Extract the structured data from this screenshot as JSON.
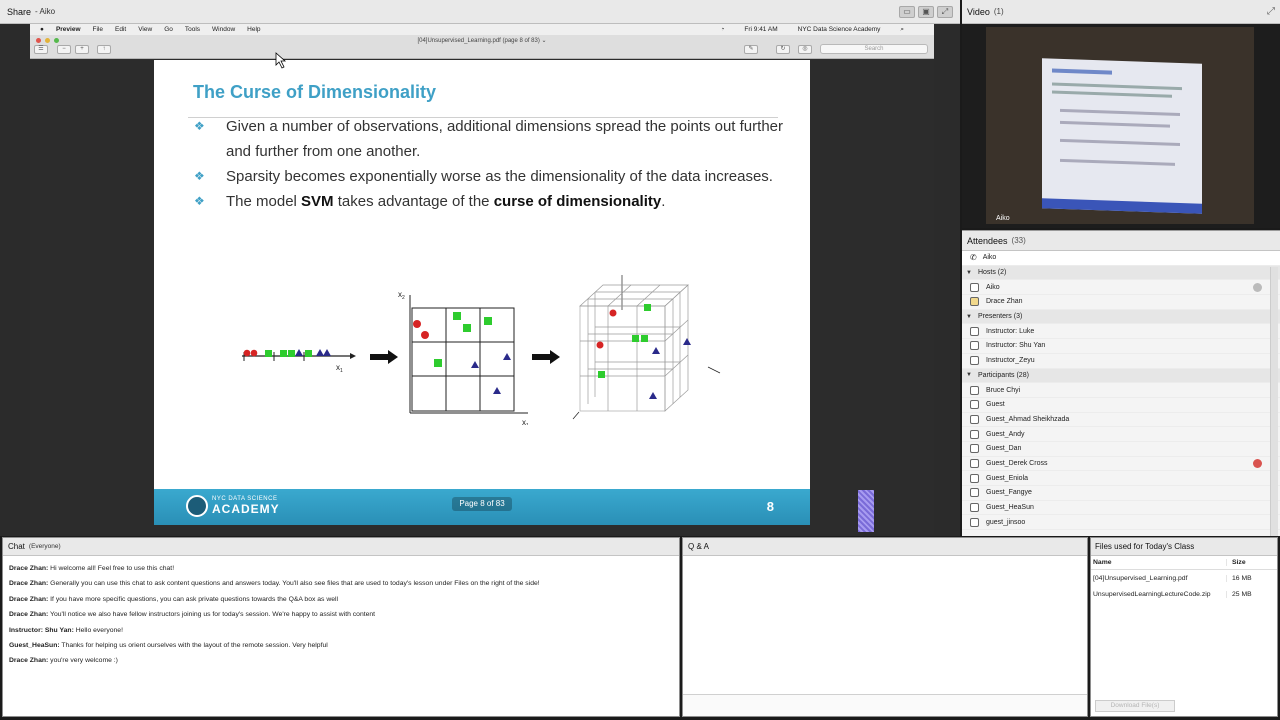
{
  "share": {
    "title": "Share",
    "subtitle": "- Aiko"
  },
  "mac_menu": {
    "items": [
      "Preview",
      "File",
      "Edit",
      "View",
      "Go",
      "Tools",
      "Window",
      "Help"
    ],
    "clock": "Fri 9:41 AM",
    "org": "NYC Data Science Academy"
  },
  "preview": {
    "doc_title": "[04]Unsupervised_Learning.pdf (page 8 of 83) ⌄",
    "search_placeholder": "Search"
  },
  "slide": {
    "title": "The Curse of Dimensionality",
    "bullets": [
      {
        "pre": "Given a number of observations, additional dimensions spread the points out further and further from one another.",
        "b1": "",
        "mid": "",
        "b2": "",
        "post": ""
      },
      {
        "pre": "Sparsity becomes exponentially worse as the dimensionality of the data increases.",
        "b1": "",
        "mid": "",
        "b2": "",
        "post": ""
      },
      {
        "pre": "The model ",
        "b1": "SVM",
        "mid": " takes advantage of the ",
        "b2": "curse of dimensionality",
        "post": "."
      }
    ],
    "fig": {
      "x1": "x",
      "x1_sub": "1",
      "x2": "x",
      "x2_sub": "2"
    },
    "logo_line1": "NYC DATA SCIENCE",
    "logo_line2": "ACADEMY",
    "page_indicator": "Page 8 of 83",
    "page_number": "8"
  },
  "video": {
    "title": "Video",
    "count": "(1)",
    "name": "Aiko"
  },
  "attendees": {
    "title": "Attendees",
    "count": "(33)",
    "me": "Aiko",
    "hosts_label": "Hosts (2)",
    "hosts": [
      "Aiko",
      "Drace Zhan"
    ],
    "presenters_label": "Presenters (3)",
    "presenters": [
      "Instructor: Luke",
      "Instructor: Shu Yan",
      "Instructor_Zeyu"
    ],
    "participants_label": "Participants (28)",
    "participants": [
      "Bruce Chyi",
      "Guest",
      "Guest_Ahmad Sheikhzada",
      "Guest_Andy",
      "Guest_Dan",
      "Guest_Derek Cross",
      "Guest_Eniola",
      "Guest_Fangye",
      "Guest_HeaSun",
      "guest_jinsoo"
    ]
  },
  "chat": {
    "title": "Chat",
    "scope": "(Everyone)",
    "messages": [
      {
        "from": "Drace Zhan:",
        "text": " Hi welcome all! Feel free to use this chat!"
      },
      {
        "from": "Drace Zhan:",
        "text": " Generally you can use this chat to ask content questions and answers today. You'll also see files that are used to today's lesson under Files on the right of  the side!"
      },
      {
        "from": "Drace Zhan:",
        "text": " If you have more specific questions, you can ask private questions towards the Q&A box as well"
      },
      {
        "from": "Drace Zhan:",
        "text": " You'll notice we also have fellow instructors joining us for today's session. We're happy to assist with content"
      },
      {
        "from": "Instructor: Shu Yan:",
        "text": " Hello everyone!"
      },
      {
        "from": "Guest_HeaSun:",
        "text": " Thanks for helping us orient ourselves with the layout of the remote session. Very helpful"
      },
      {
        "from": "Drace Zhan:",
        "text": " you're very welcome :)"
      }
    ]
  },
  "qa": {
    "title": "Q & A"
  },
  "files": {
    "title": "Files used for Today's Class",
    "col_name": "Name",
    "col_size": "Size",
    "rows": [
      {
        "name": "[04]Unsupervised_Learning.pdf",
        "size": "16 MB"
      },
      {
        "name": "UnsupervisedLearningLectureCode.zip",
        "size": "25 MB"
      }
    ],
    "download_label": "Download File(s)"
  },
  "colors": {
    "accent": "#3fa0c6",
    "red_point": "#d62424",
    "green_point": "#2ecc2e",
    "blue_point": "#2a2a8a"
  }
}
